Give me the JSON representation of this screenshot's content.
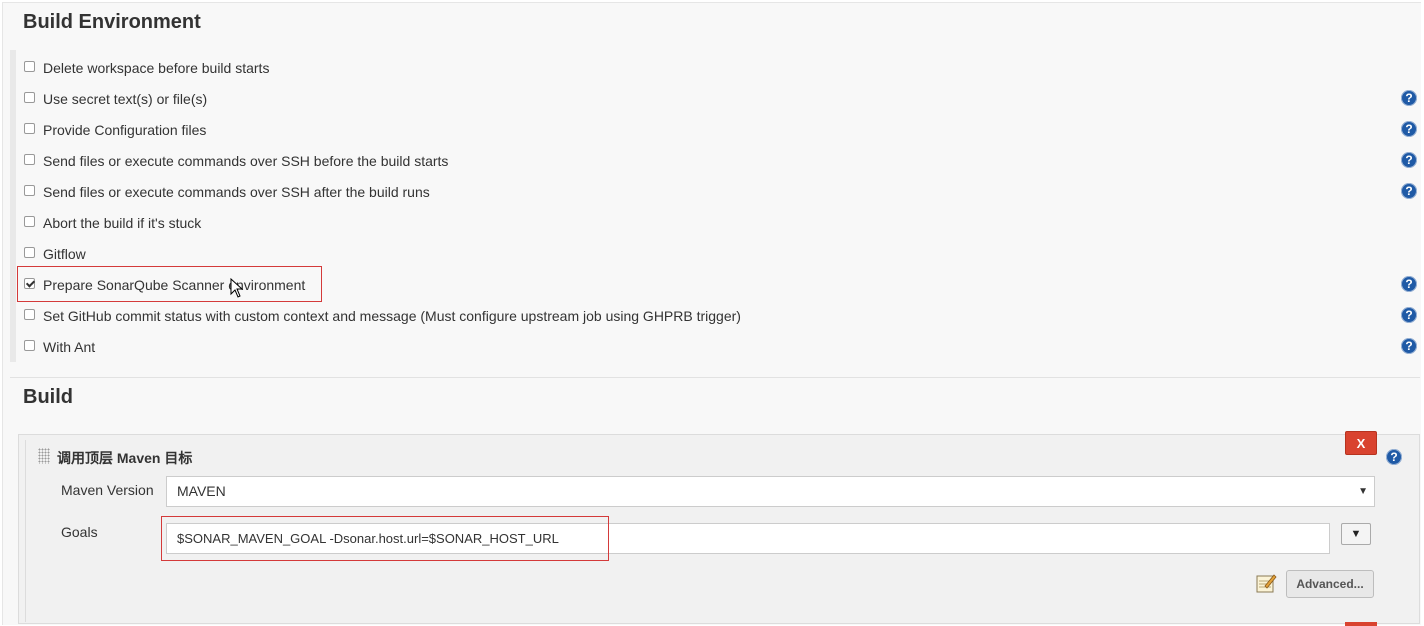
{
  "build_environment": {
    "title": "Build Environment",
    "options": [
      {
        "label": "Delete workspace before build starts",
        "checked": false,
        "help": false
      },
      {
        "label": "Use secret text(s) or file(s)",
        "checked": false,
        "help": true
      },
      {
        "label": "Provide Configuration files",
        "checked": false,
        "help": true
      },
      {
        "label": "Send files or execute commands over SSH before the build starts",
        "checked": false,
        "help": true
      },
      {
        "label": "Send files or execute commands over SSH after the build runs",
        "checked": false,
        "help": true
      },
      {
        "label": "Abort the build if it's stuck",
        "checked": false,
        "help": false
      },
      {
        "label": "Gitflow",
        "checked": false,
        "help": false
      },
      {
        "label": "Prepare SonarQube Scanner environment",
        "checked": true,
        "help": true
      },
      {
        "label": "Set GitHub commit status with custom context and message (Must configure upstream job using GHPRB trigger)",
        "checked": false,
        "help": true
      },
      {
        "label": "With Ant",
        "checked": false,
        "help": true
      }
    ]
  },
  "build": {
    "title": "Build",
    "step": {
      "title": "调用顶层 Maven 目标",
      "delete_label": "X",
      "maven_version_label": "Maven Version",
      "maven_version_value": "MAVEN",
      "goals_label": "Goals",
      "goals_value": "$SONAR_MAVEN_GOAL -Dsonar.host.url=$SONAR_HOST_URL",
      "expand_label": "▼",
      "advanced_label": "Advanced..."
    }
  },
  "icons": {
    "help": "help-icon",
    "notepad": "notepad-icon",
    "cursor": "mouse-cursor-icon"
  },
  "colors": {
    "help_blue": "#1f5aa6",
    "delete_red": "#d9432f",
    "highlight_red": "#d43a3a"
  }
}
